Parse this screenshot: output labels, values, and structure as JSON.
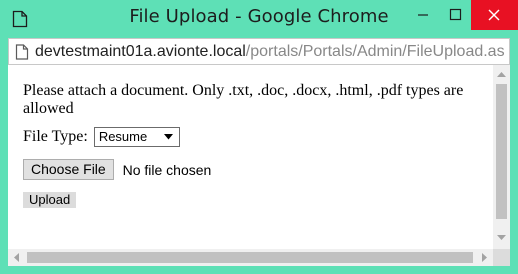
{
  "window": {
    "title": "File Upload - Google Chrome",
    "controls": {
      "minimize": "minimize-icon",
      "maximize": "maximize-icon",
      "close": "close-icon"
    },
    "close_color": "#e81123",
    "frame_color": "#5ee0b6"
  },
  "address": {
    "host": "devtestmaint01a.avionte.local",
    "path": "/portals/Portals/Admin/FileUpload.as",
    "icon": "page-icon"
  },
  "page": {
    "instructions": "Please attach a document. Only .txt, .doc, .docx, .html, .pdf types are allowed",
    "file_type_label": "File Type:",
    "file_type_value": "Resume",
    "choose_file_label": "Choose File",
    "no_file_text": "No file chosen",
    "upload_label": "Upload"
  }
}
